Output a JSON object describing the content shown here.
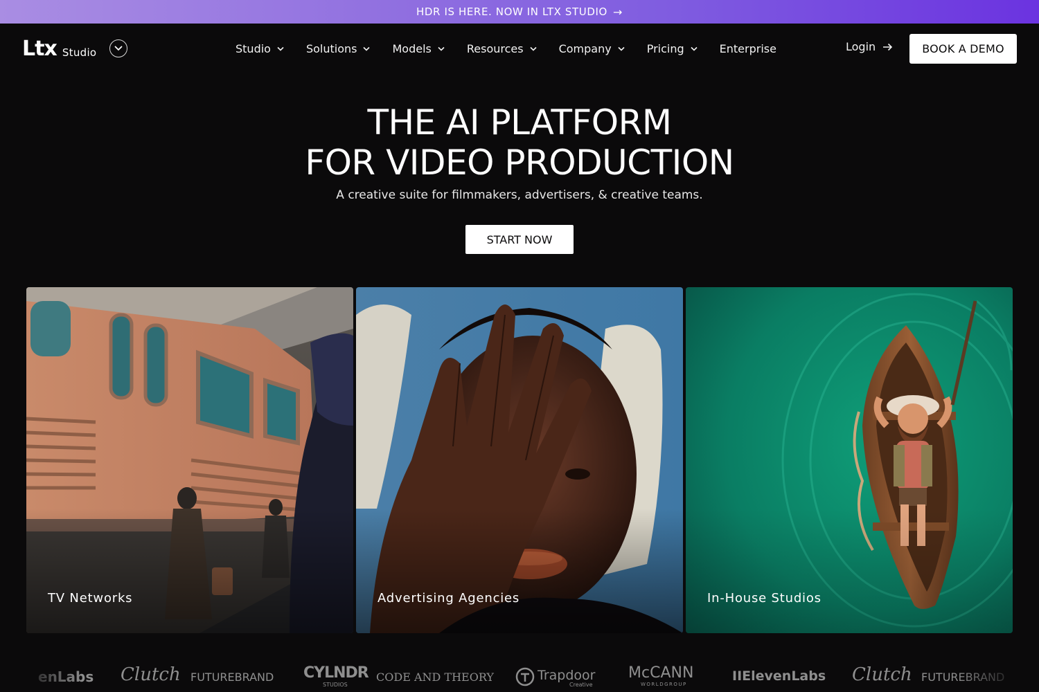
{
  "announcement": {
    "text": "HDR IS HERE. NOW IN LTX STUDIO",
    "arrow": "→"
  },
  "brand": {
    "logo_mark": "Ltx",
    "logo_word": "Studio"
  },
  "nav": {
    "items": [
      {
        "label": "Studio",
        "has_dropdown": true
      },
      {
        "label": "Solutions",
        "has_dropdown": true
      },
      {
        "label": "Models",
        "has_dropdown": true
      },
      {
        "label": "Resources",
        "has_dropdown": true
      },
      {
        "label": "Company",
        "has_dropdown": true
      },
      {
        "label": "Pricing",
        "has_dropdown": true
      },
      {
        "label": "Enterprise",
        "has_dropdown": false
      }
    ],
    "login_label": "Login",
    "demo_label": "BOOK A DEMO"
  },
  "hero": {
    "title_line1": "THE AI PLATFORM",
    "title_line2": "FOR VIDEO PRODUCTION",
    "subtitle": "A creative suite for filmmakers, advertisers, & creative teams.",
    "cta_label": "START NOW"
  },
  "cards": [
    {
      "label": "TV Networks"
    },
    {
      "label": "Advertising Agencies"
    },
    {
      "label": "In-House Studios"
    }
  ],
  "partners": [
    "enLabs",
    "Clutch",
    "FUTUREBRAND",
    "CYLNDR",
    "STUDIOS",
    "CODE AND THEORY",
    "Trapdoor",
    "Creative",
    "McCANN",
    "WORLDGROUP",
    "IIElevenLabs",
    "Clutch",
    "FUTUREBRAND"
  ],
  "colors": {
    "background": "#0b0a0b",
    "announcement_start": "#a98de3",
    "announcement_end": "#6b33e0",
    "button_bg": "#ffffff",
    "partner_logo": "#8f8f8f"
  }
}
